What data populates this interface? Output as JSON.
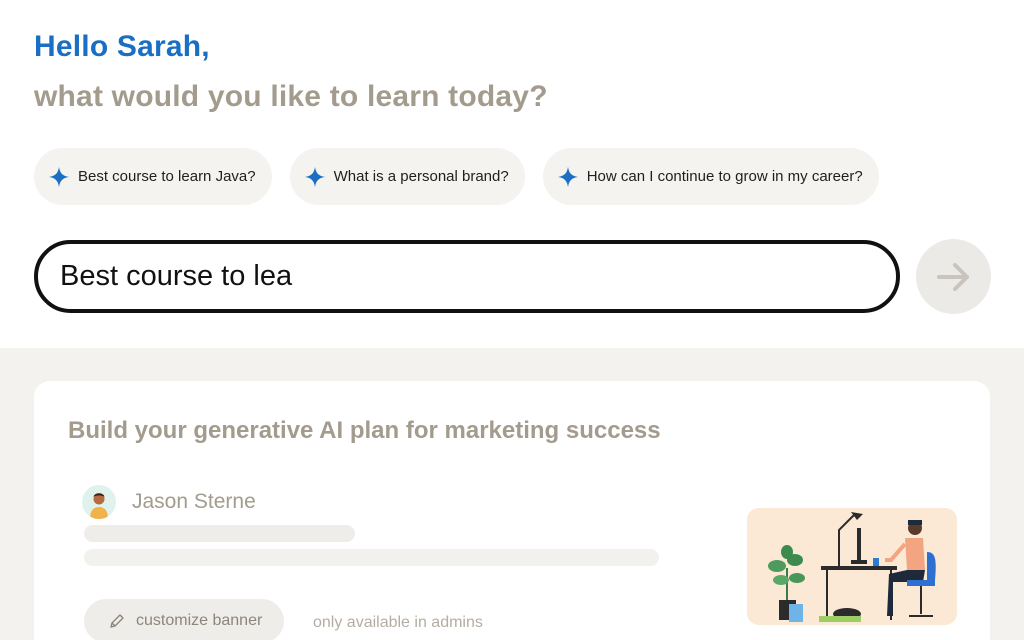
{
  "greeting": "Hello Sarah,",
  "subtitle": "what would you like to learn today?",
  "suggestions": [
    {
      "label": "Best course to learn Java?",
      "icon": "sparkle-icon"
    },
    {
      "label": "What is a personal brand?",
      "icon": "sparkle-icon"
    },
    {
      "label": "How can I continue to grow in my career?",
      "icon": "sparkle-icon"
    }
  ],
  "search": {
    "value": "Best course to lea",
    "submit_icon": "arrow-right-icon"
  },
  "card": {
    "title": "Build your generative AI plan for marketing success",
    "author": "Jason Sterne",
    "customize_label": "customize banner",
    "customize_icon": "pencil-icon",
    "admin_note": "only available in admins"
  },
  "colors": {
    "accent": "#1a6fc4",
    "muted": "#a39b8d",
    "chip_bg": "#f5f3f0",
    "section_bg": "#f3f2ef"
  }
}
